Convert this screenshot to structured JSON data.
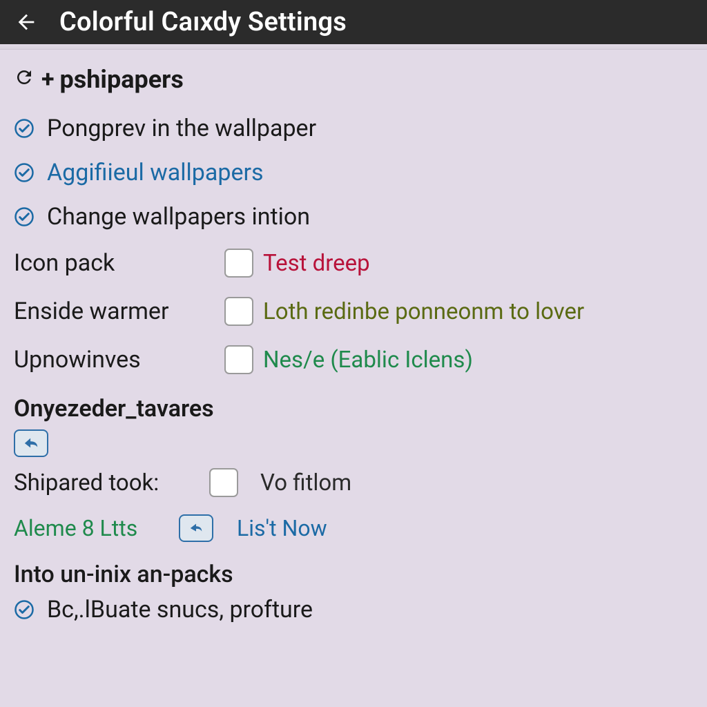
{
  "header": {
    "title": "Colorful Caıxdy Settings"
  },
  "section1": {
    "heading": "pshipapers",
    "items": [
      {
        "label": "Pongprev in the wallpaper",
        "link": false
      },
      {
        "label": "Aggifiieul wallpapers",
        "link": true
      },
      {
        "label": "Change wallpapers intion",
        "link": false
      }
    ]
  },
  "kv": {
    "icon_pack": {
      "label": "Icon pack",
      "desc": "Test dreep",
      "color": "red"
    },
    "enside_warmer": {
      "label": "Enside warmer",
      "desc": "Loth redinbe ponneonm to lover",
      "color": "olive"
    },
    "upnowinves": {
      "label": "Upnowinves",
      "desc": "Nes/e (Eablic Iclens)",
      "color": "green"
    }
  },
  "section2": {
    "heading": "Onyezeder_tavares",
    "shipared": {
      "label": "Shipared took:",
      "desc": "Vo fitlom"
    },
    "aleme": {
      "status": "Aleme 8 Ltts",
      "action": "Lis't Now"
    }
  },
  "footer": {
    "heading": "Into un-inix an-packs",
    "item": "Bc,.lBuate snucs, profture"
  },
  "colors": {
    "accent_blue": "#1b6aa5",
    "accent_green": "#1f8a4c",
    "accent_red": "#b8123a",
    "accent_olive": "#5a6a12",
    "bg": "#e2dae7",
    "topbar": "#2b2b2b"
  }
}
